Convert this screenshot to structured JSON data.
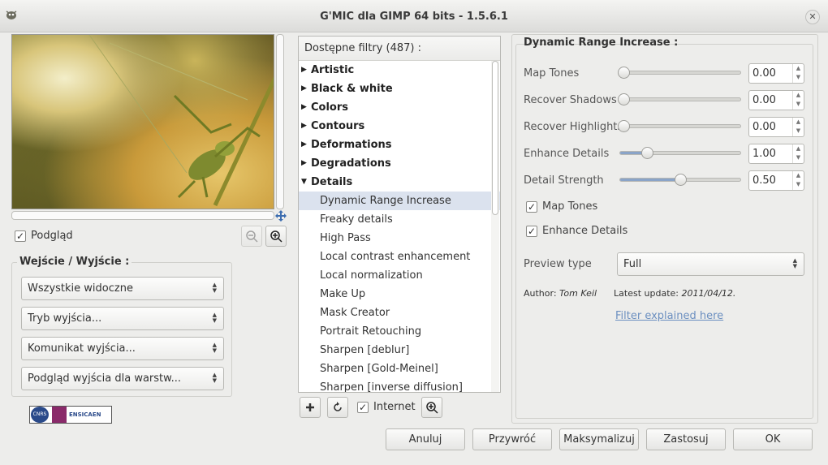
{
  "window": {
    "title": "G'MIC dla GIMP 64 bits - 1.5.6.1"
  },
  "preview": {
    "checkbox_label": "Podgląd",
    "checked": true
  },
  "io": {
    "title": "Wejście / Wyjście :",
    "combos": [
      "Wszystkie widoczne",
      "Tryb wyjścia...",
      "Komunikat wyjścia...",
      "Podgląd wyjścia dla warstw..."
    ]
  },
  "logo": {
    "text_left": "CNRS",
    "text_right": "ENSICAEN"
  },
  "filters": {
    "header": "Dostępne filtry (487) :",
    "categories": [
      "Artistic",
      "Black & white",
      "Colors",
      "Contours",
      "Deformations",
      "Degradations"
    ],
    "open_category": "Details",
    "items": [
      "Dynamic Range Increase",
      "Freaky details",
      "High Pass",
      "Local contrast enhancement",
      "Local normalization",
      "Make Up",
      "Mask Creator",
      "Portrait Retouching",
      "Sharpen [deblur]",
      "Sharpen [Gold-Meinel]",
      "Sharpen [inverse diffusion]"
    ],
    "internet_label": "Internet",
    "internet_checked": true
  },
  "params": {
    "title": "Dynamic Range Increase :",
    "sliders": [
      {
        "label": "Map Tones",
        "value": "0.00",
        "level": 0.0
      },
      {
        "label": "Recover Shadows",
        "value": "0.00",
        "level": 0.0
      },
      {
        "label": "Recover Highlights",
        "value": "0.00",
        "level": 0.0
      },
      {
        "label": "Enhance Details",
        "value": "1.00",
        "level": 0.22
      },
      {
        "label": "Detail Strength",
        "value": "0.50",
        "level": 0.5
      }
    ],
    "checkboxes": [
      {
        "label": "Map Tones",
        "checked": true
      },
      {
        "label": "Enhance Details",
        "checked": true
      }
    ],
    "preview_type_label": "Preview type",
    "preview_type_value": "Full",
    "author_label": "Author:",
    "author": "Tom Keil",
    "update_label": "Latest update:",
    "update": "2011/04/12.",
    "link": "Filter explained here"
  },
  "buttons": {
    "cancel": "Anuluj",
    "reset": "Przywróć",
    "maximize": "Maksymalizuj",
    "apply": "Zastosuj",
    "ok": "OK"
  },
  "colors": {
    "selection": "#dbe2ee",
    "link": "#6b8fc0",
    "slider_fill": "#8aa4c8"
  }
}
